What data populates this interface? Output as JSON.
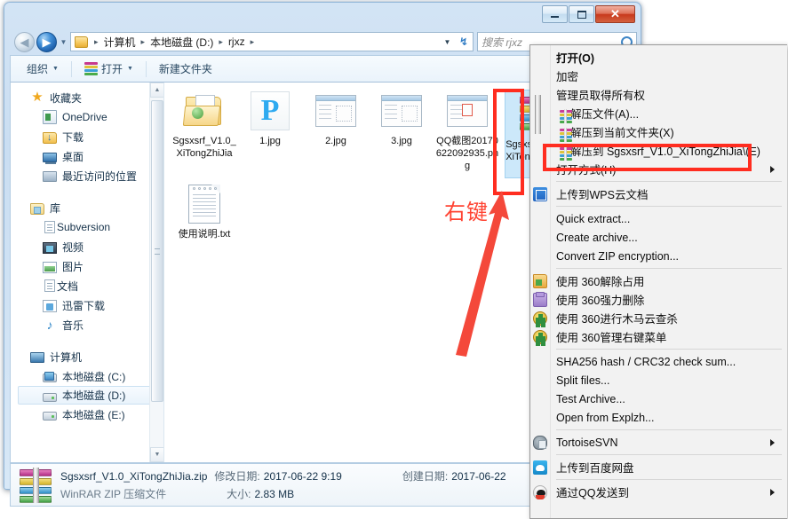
{
  "window": {
    "buttons": {
      "minimize": "minimize-button",
      "maximize": "maximize-button",
      "close": "✕"
    }
  },
  "address": {
    "back_glyph": "◀",
    "forward_glyph": "▶",
    "history_glyph": "▼",
    "crumbs": [
      "计算机",
      "本地磁盘 (D:)",
      "rjxz"
    ],
    "separator": "▸",
    "dropdown_glyph": "▼",
    "refresh_glyph": "↯"
  },
  "search": {
    "placeholder": "搜索 rjxz"
  },
  "toolbar": {
    "organize": "组织",
    "open": "打开",
    "new_folder": "新建文件夹",
    "caret": "▼"
  },
  "nav_pane": {
    "groups": [
      {
        "header": {
          "label": "收藏夹",
          "icon": "star-icon"
        },
        "items": [
          {
            "label": "OneDrive",
            "icon": "onedrive-icon"
          },
          {
            "label": "下载",
            "icon": "downloads-folder-icon"
          },
          {
            "label": "桌面",
            "icon": "desktop-icon"
          },
          {
            "label": "最近访问的位置",
            "icon": "recent-places-icon"
          }
        ]
      },
      {
        "header": {
          "label": "库",
          "icon": "library-icon"
        },
        "items": [
          {
            "label": "Subversion",
            "icon": "document-icon"
          },
          {
            "label": "视频",
            "icon": "video-icon"
          },
          {
            "label": "图片",
            "icon": "pictures-icon"
          },
          {
            "label": "文档",
            "icon": "document-icon"
          },
          {
            "label": "迅雷下载",
            "icon": "xunlei-icon"
          },
          {
            "label": "音乐",
            "icon": "music-note-icon"
          }
        ]
      },
      {
        "header": {
          "label": "计算机",
          "icon": "computer-icon"
        },
        "items": [
          {
            "label": "本地磁盘 (C:)",
            "icon": "system-drive-icon",
            "selected": false
          },
          {
            "label": "本地磁盘 (D:)",
            "icon": "drive-icon",
            "selected": true
          },
          {
            "label": "本地磁盘 (E:)",
            "icon": "drive-icon",
            "selected": false
          }
        ]
      }
    ]
  },
  "files": [
    {
      "name": "Sgsxsrf_V1.0_XiTongZhiJia",
      "icon": "open-folder-icon"
    },
    {
      "name": "1.jpg",
      "icon": "image-ps-icon"
    },
    {
      "name": "2.jpg",
      "icon": "screenshot-icon"
    },
    {
      "name": "3.jpg",
      "icon": "screenshot-icon"
    },
    {
      "name": "QQ截图20170622092935.png",
      "icon": "qq-screenshot-icon"
    },
    {
      "name": "使用说明.txt",
      "icon": "text-file-icon"
    }
  ],
  "selected_file": {
    "name": "Sgsxsrf_V1.0_XiTongZhiJia.zip",
    "icon": "winrar-zip-icon"
  },
  "status_bar": {
    "file_name": "Sgsxsrf_V1.0_XiTongZhiJia.zip",
    "modified_key": "修改日期:",
    "modified_value": "2017-06-22 9:19",
    "created_key": "创建日期:",
    "created_value": "2017-06-22",
    "file_type": "WinRAR ZIP 压缩文件",
    "size_key": "大小:",
    "size_value": "2.83 MB"
  },
  "context_menu": {
    "items": [
      {
        "label": "打开(O)",
        "icon": null,
        "bold": true,
        "submenu": false
      },
      {
        "label": "加密",
        "icon": null,
        "bold": false,
        "submenu": false
      },
      {
        "label": "管理员取得所有权",
        "icon": null,
        "bold": false,
        "submenu": false
      },
      {
        "label": "解压文件(A)...",
        "icon": "winrar-icon",
        "bold": false,
        "submenu": false
      },
      {
        "label": "解压到当前文件夹(X)",
        "icon": "winrar-icon",
        "bold": false,
        "submenu": false
      },
      {
        "label": "解压到 Sgsxsrf_V1.0_XiTongZhiJia\\(E)",
        "icon": "winrar-icon",
        "bold": false,
        "submenu": false,
        "highlighted": true
      },
      {
        "label": "打开方式(H)",
        "icon": null,
        "bold": false,
        "submenu": true
      },
      {
        "separator": true
      },
      {
        "label": "上传到WPS云文档",
        "icon": "wps-cloud-icon",
        "bold": false,
        "submenu": false
      },
      {
        "separator": true
      },
      {
        "label": "Quick extract...",
        "icon": null,
        "bold": false,
        "submenu": false
      },
      {
        "label": "Create archive...",
        "icon": null,
        "bold": false,
        "submenu": false
      },
      {
        "label": "Convert ZIP encryption...",
        "icon": null,
        "bold": false,
        "submenu": false
      },
      {
        "separator": true
      },
      {
        "label": "使用 360解除占用",
        "icon": "360-folder-icon",
        "bold": false,
        "submenu": false
      },
      {
        "label": "使用 360强力删除",
        "icon": "360-trash-icon",
        "bold": false,
        "submenu": false
      },
      {
        "label": "使用 360进行木马云查杀",
        "icon": "360-shield-icon",
        "bold": false,
        "submenu": false
      },
      {
        "label": "使用 360管理右键菜单",
        "icon": "360-shield-icon",
        "bold": false,
        "submenu": false
      },
      {
        "separator": true
      },
      {
        "label": "SHA256 hash / CRC32 check sum...",
        "icon": null,
        "bold": false,
        "submenu": false
      },
      {
        "label": "Split files...",
        "icon": null,
        "bold": false,
        "submenu": false
      },
      {
        "label": "Test Archive...",
        "icon": null,
        "bold": false,
        "submenu": false
      },
      {
        "label": "Open from Explzh...",
        "icon": null,
        "bold": false,
        "submenu": false
      },
      {
        "separator": true
      },
      {
        "label": "TortoiseSVN",
        "icon": "tortoise-svn-icon",
        "bold": false,
        "submenu": true
      },
      {
        "separator": true
      },
      {
        "label": "上传到百度网盘",
        "icon": "baidu-netdisk-icon",
        "bold": false,
        "submenu": false
      },
      {
        "separator": true
      },
      {
        "label": "通过QQ发送到",
        "icon": "qq-icon",
        "bold": false,
        "submenu": true
      }
    ]
  },
  "annotations": {
    "right_click_label": "右键",
    "highlight_color": "#ff2d20",
    "arrow_color": "#f4483a"
  }
}
